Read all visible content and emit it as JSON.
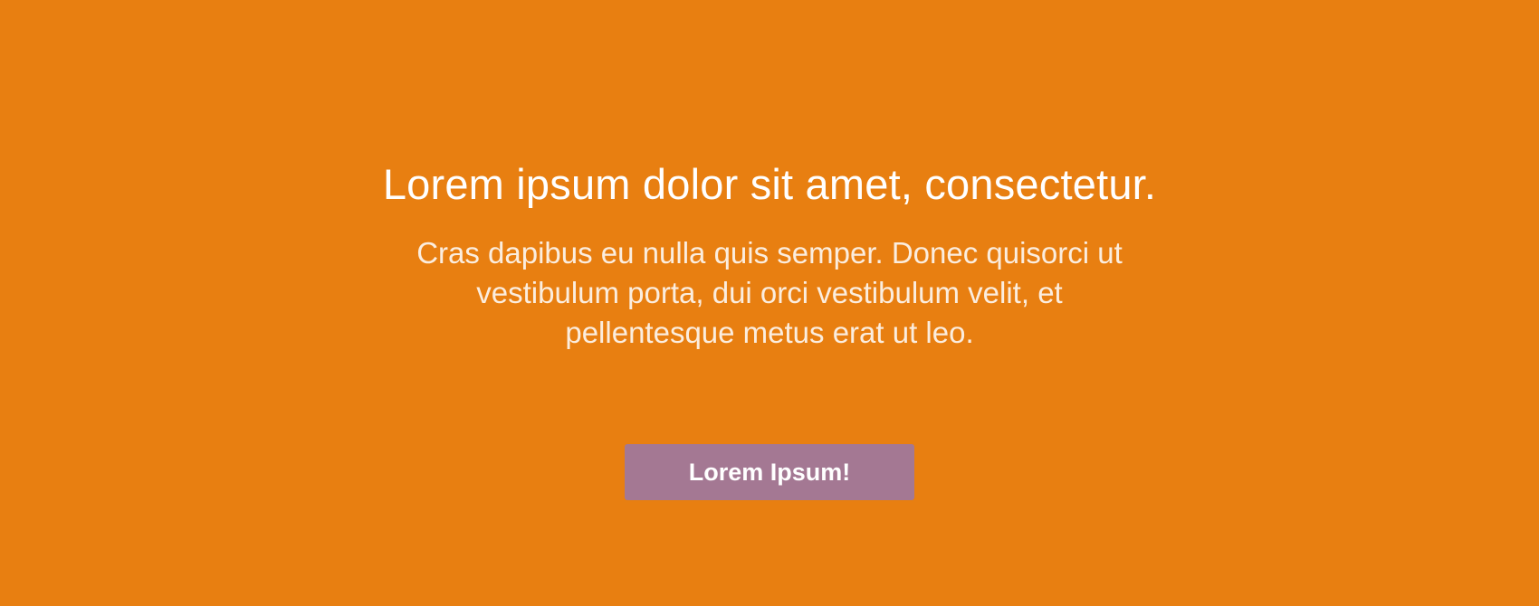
{
  "hero": {
    "headline": "Lorem ipsum dolor sit amet, consectetur.",
    "subtext": "Cras dapibus eu nulla quis semper. Donec quisorci ut vestibulum porta, dui orci vestibulum velit, et pellentesque metus erat ut leo.",
    "cta_label": "Lorem Ipsum!"
  },
  "colors": {
    "background": "#e87f11",
    "button": "#a47893",
    "text": "#ffffff"
  }
}
